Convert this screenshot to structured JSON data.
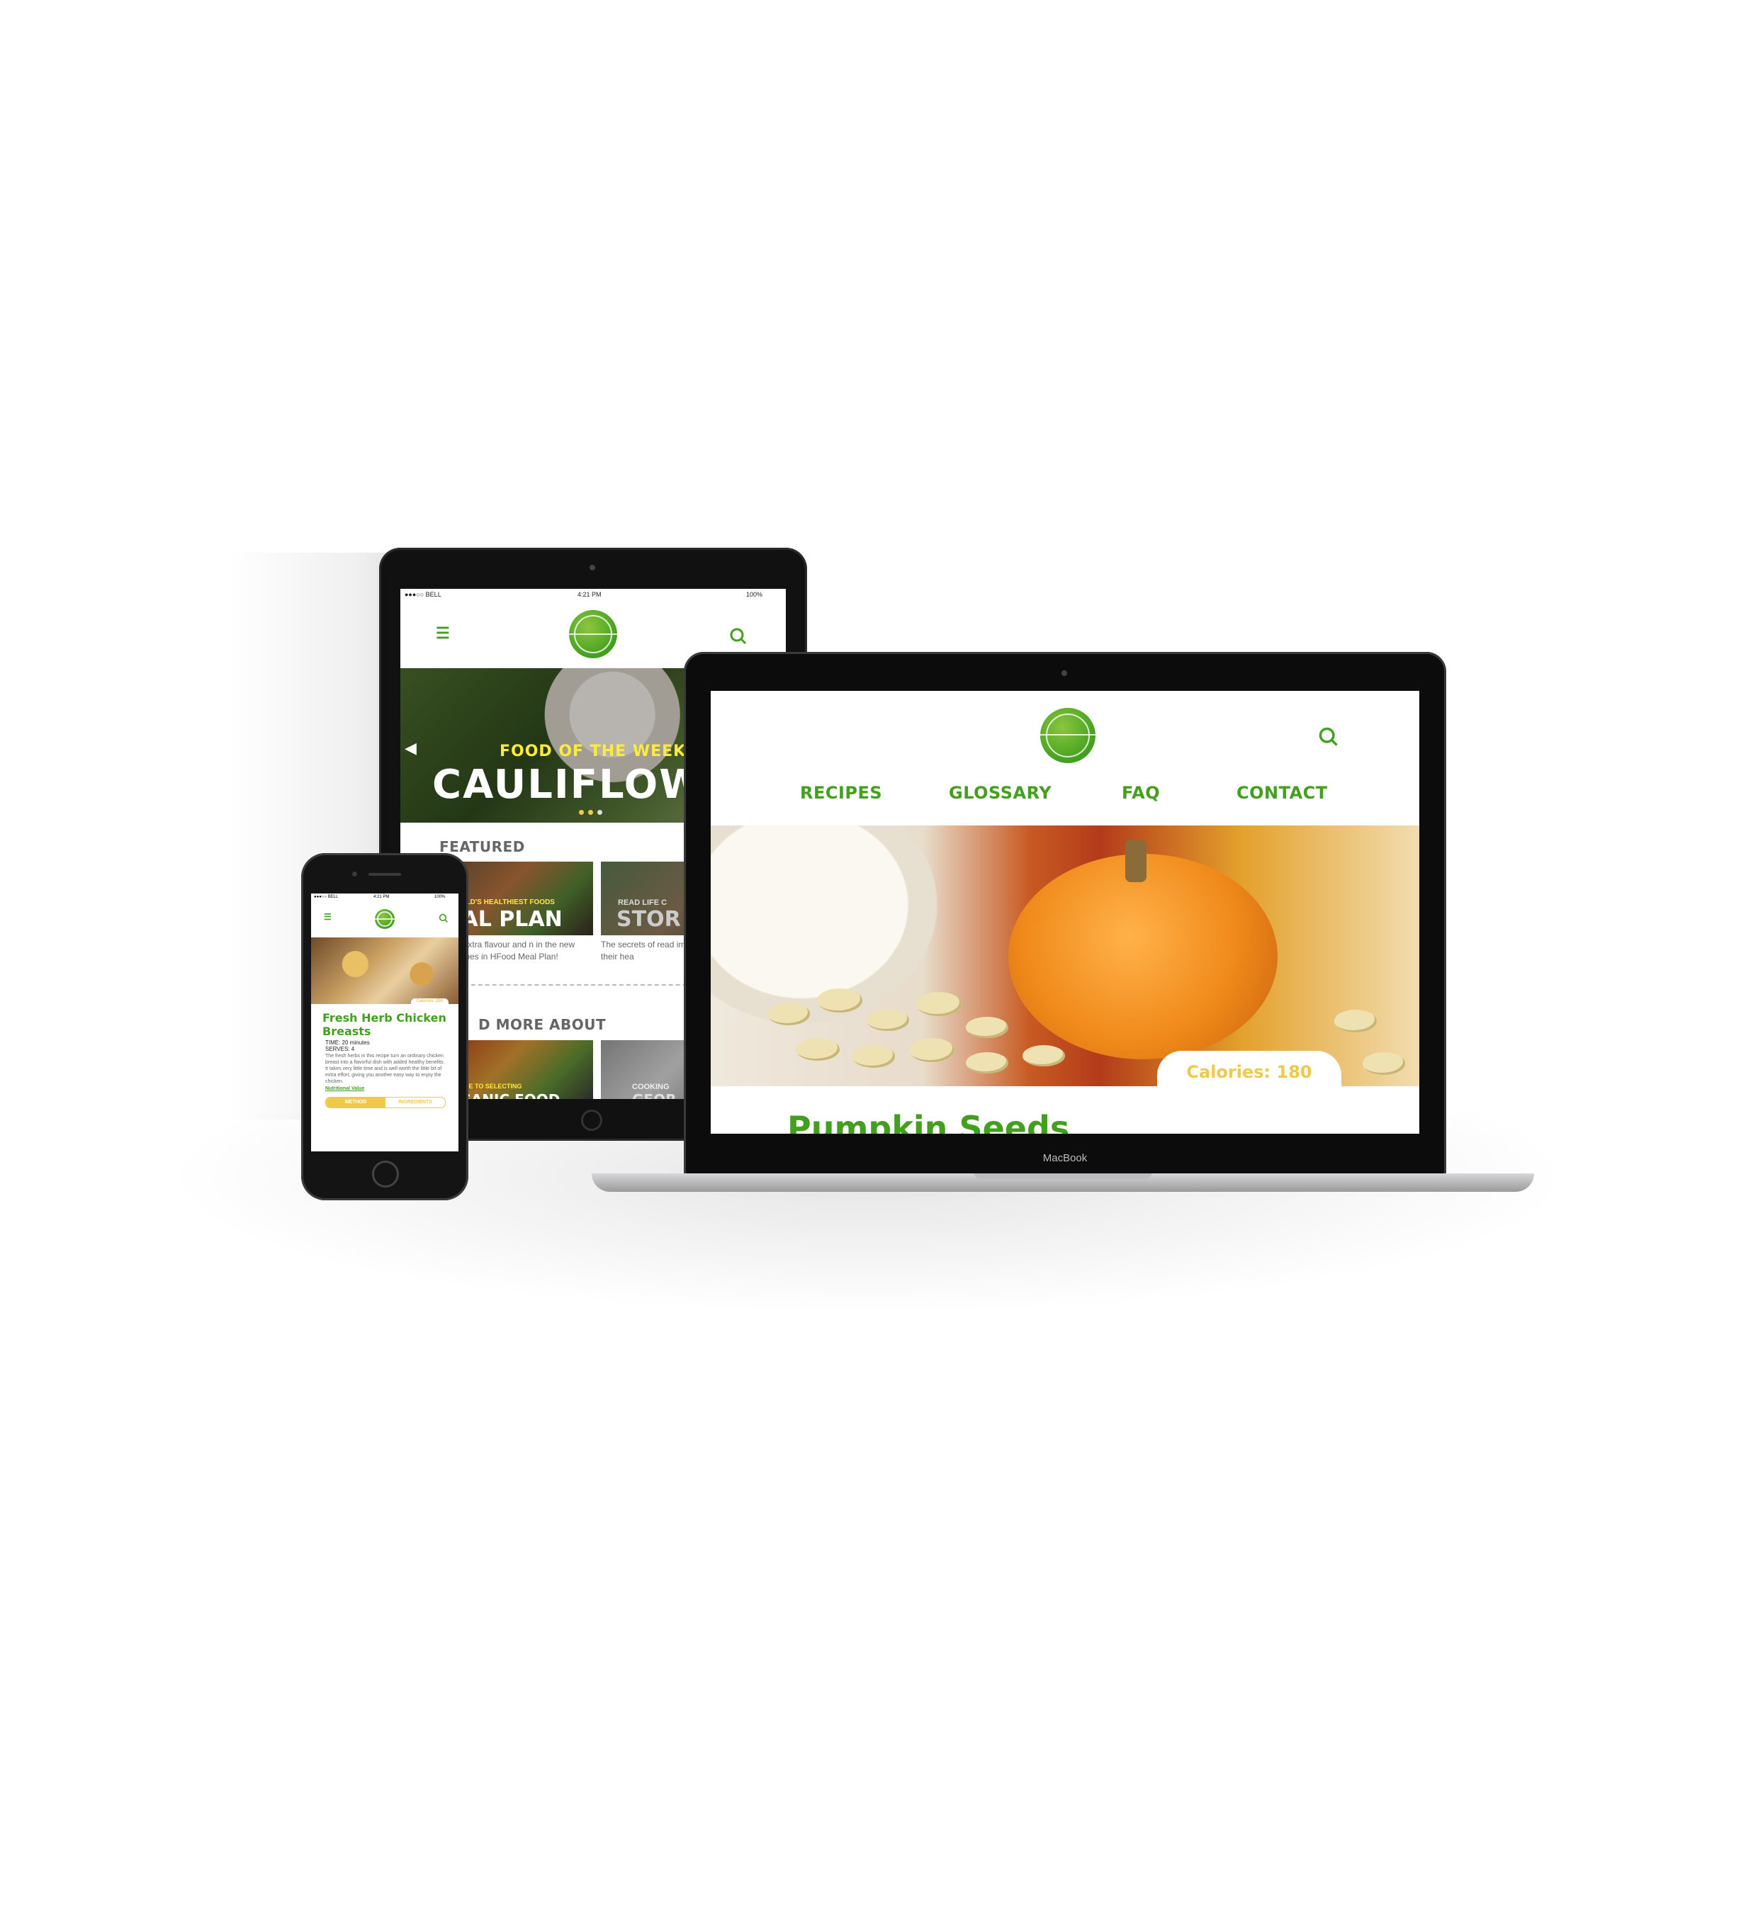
{
  "colors": {
    "brand_green": "#43a01e",
    "accent_yellow": "#f0c949",
    "bright_yellow": "#ffeb3b"
  },
  "tablet": {
    "status": {
      "carrier": "●●●○○ BELL",
      "time": "4:21 PM",
      "battery": "100%"
    },
    "hero": {
      "kicker": "FOOD OF THE WEEK",
      "headline": "CAULIFLOW"
    },
    "featured_title": "FEATURED",
    "cards": [
      {
        "overline": "WORLD'S HEALTHIEST FOODS",
        "headline": "EAL PLAN",
        "text": "he extra flavour and n in the new recipes in HFood Meal Plan!"
      },
      {
        "overline": "READ LIFE C",
        "headline": "STOR",
        "text": "The secrets of read improved their hea"
      }
    ],
    "read_more_title": "D MORE ABOUT",
    "more_cards": [
      {
        "overline": "GUIDE TO SELECTING",
        "headline": "RGANIC FOOD"
      },
      {
        "overline": "COOKING",
        "headline": "GEOR"
      }
    ]
  },
  "laptop": {
    "nav": [
      "RECIPES",
      "GLOSSARY",
      "FAQ",
      "CONTACT"
    ],
    "calories": "Calories: 180",
    "title": "Pumpkin Seeds",
    "brand": "MacBook"
  },
  "phone": {
    "status": {
      "carrier": "●●●○○ BELL",
      "time": "4:21 PM",
      "battery": "100%"
    },
    "calorie_tag": "Calories: 250",
    "title": "Fresh Herb Chicken Breasts",
    "time": "TIME: 20 minutes",
    "serves": "SERVES: 4",
    "body": "The fresh herbs in this recipe turn an ordinary chicken breast into a flavorful dish with added healthy benefits. It takes very little time and is well worth the little bit of extra effort, giving you another easy way to enjoy the chicken.",
    "link": "Nutritional Value",
    "tabs": [
      "METHOD",
      "INGREDIENTS"
    ]
  }
}
